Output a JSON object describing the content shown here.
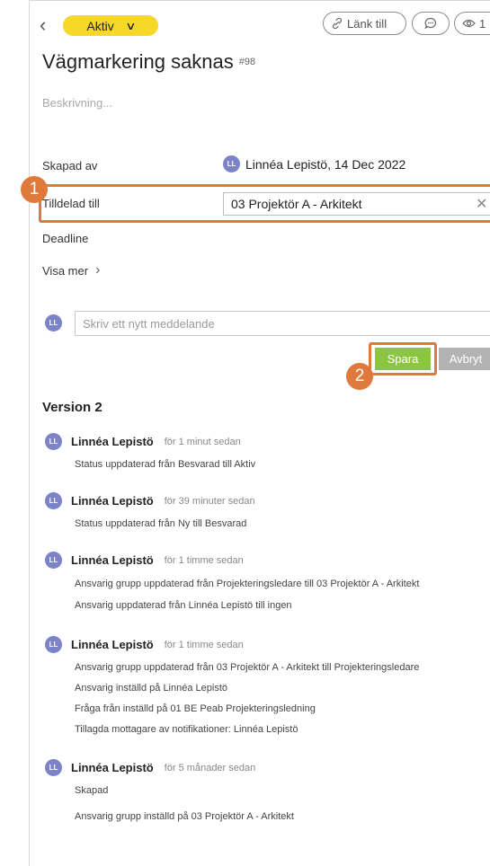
{
  "header": {
    "status": "Aktiv",
    "link_label": "Länk till",
    "watchers_count": "1"
  },
  "task": {
    "title": "Vägmarkering saknas",
    "number": "#98",
    "description_placeholder": "Beskrivning..."
  },
  "fields": {
    "created_by_label": "Skapad av",
    "created_by_avatar": "LL",
    "created_by_value": "Linnéa Lepistö, 14 Dec 2022",
    "assigned_label": "Tilldelad till",
    "assigned_value": "03 Projektör A - Arkitekt",
    "deadline_label": "Deadline",
    "show_more_label": "Visa mer"
  },
  "message": {
    "avatar": "LL",
    "placeholder": "Skriv ett nytt meddelande",
    "save_label": "Spara",
    "cancel_label": "Avbryt"
  },
  "markers": [
    "1",
    "2"
  ],
  "version": {
    "title": "Version 2",
    "entries": [
      {
        "avatar": "LL",
        "name": "Linnéa Lepistö",
        "time": "för 1 minut sedan",
        "lines": [
          "Status uppdaterad från Besvarad till Aktiv"
        ]
      },
      {
        "avatar": "LL",
        "name": "Linnéa Lepistö",
        "time": "för 39 minuter sedan",
        "lines": [
          "Status uppdaterad från Ny till Besvarad"
        ]
      },
      {
        "avatar": "LL",
        "name": "Linnéa Lepistö",
        "time": "för 1 timme sedan",
        "lines": [
          "Ansvarig grupp uppdaterad från Projekteringsledare till 03 Projektör A - Arkitekt",
          "Ansvarig uppdaterad från Linnéa Lepistö till ingen"
        ]
      },
      {
        "avatar": "LL",
        "name": "Linnéa Lepistö",
        "time": "för 1 timme sedan",
        "lines": [
          "Ansvarig grupp uppdaterad från 03 Projektör A - Arkitekt till Projekteringsledare",
          "Ansvarig inställd på Linnéa Lepistö",
          "Fråga från inställd på 01 BE Peab Projekteringsledning",
          "Tillagda mottagare av notifikationer: Linnéa Lepistö"
        ]
      },
      {
        "avatar": "LL",
        "name": "Linnéa Lepistö",
        "time": "för 5 månader sedan",
        "lines": [
          "Skapad",
          "Ansvarig grupp inställd på 03 Projektör A - Arkitekt"
        ]
      }
    ]
  }
}
